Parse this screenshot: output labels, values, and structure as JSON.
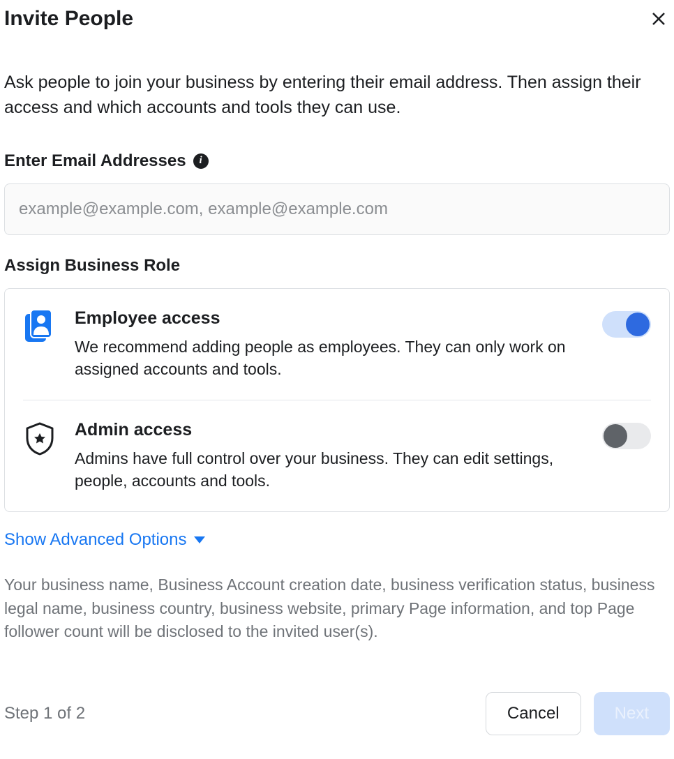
{
  "header": {
    "title": "Invite People"
  },
  "intro": "Ask people to join your business by entering their email address. Then assign their access and which accounts and tools they can use.",
  "emailSection": {
    "label": "Enter Email Addresses",
    "placeholder": "example@example.com, example@example.com",
    "value": ""
  },
  "roleSection": {
    "label": "Assign Business Role",
    "roles": [
      {
        "title": "Employee access",
        "desc": "We recommend adding people as employees. They can only work on assigned accounts and tools.",
        "enabled": true
      },
      {
        "title": "Admin access",
        "desc": "Admins have full control over your business. They can edit settings, people, accounts and tools.",
        "enabled": false
      }
    ]
  },
  "advanced": {
    "label": "Show Advanced Options"
  },
  "disclosure": "Your business name, Business Account creation date, business verification status, business legal name, business country, business website, primary Page information, and top Page follower count will be disclosed to the invited user(s).",
  "footer": {
    "step": "Step 1 of 2",
    "cancel": "Cancel",
    "next": "Next"
  }
}
